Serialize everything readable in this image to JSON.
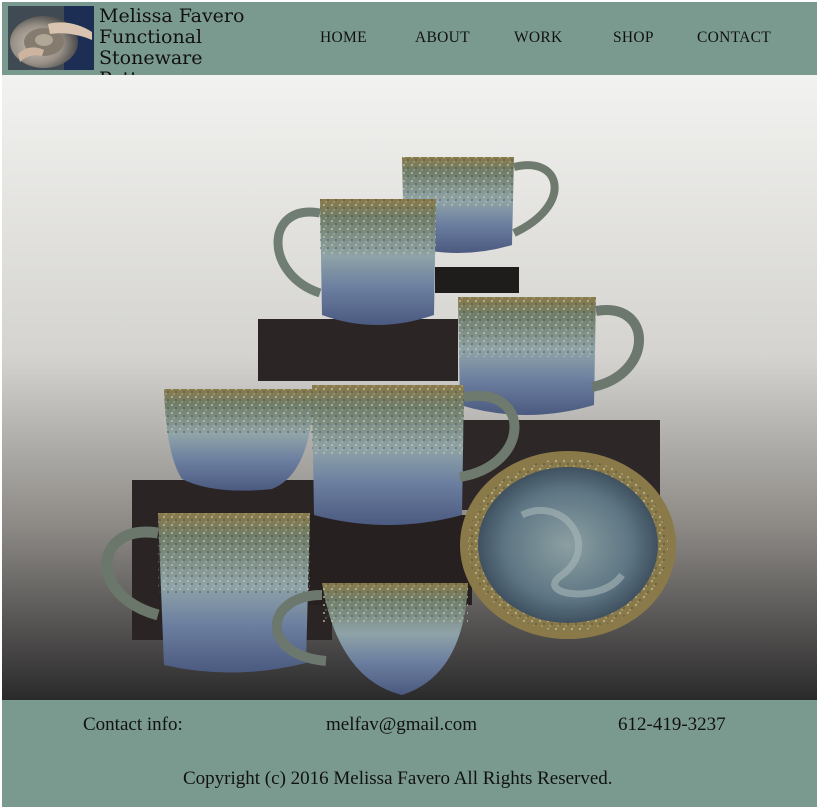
{
  "header": {
    "title_line1": "Melissa Favero",
    "title_line2": "Functional Stoneware",
    "title_line3": "Pottery",
    "logo_icon": "pottery-wheel-photo"
  },
  "nav": {
    "items": [
      {
        "label": "HOME"
      },
      {
        "label": "ABOUT"
      },
      {
        "label": "WORK"
      },
      {
        "label": "SHOP"
      },
      {
        "label": "CONTACT"
      }
    ]
  },
  "hero": {
    "image": "stoneware-mugs-and-bowl-photo"
  },
  "footer": {
    "contact_label": "Contact info:",
    "email": "melfav@gmail.com",
    "phone": "612-419-3237",
    "copyright": "Copyright (c) 2016 Melissa Favero All Rights Reserved."
  },
  "colors": {
    "band": "#7a9a8f",
    "text": "#111111"
  }
}
